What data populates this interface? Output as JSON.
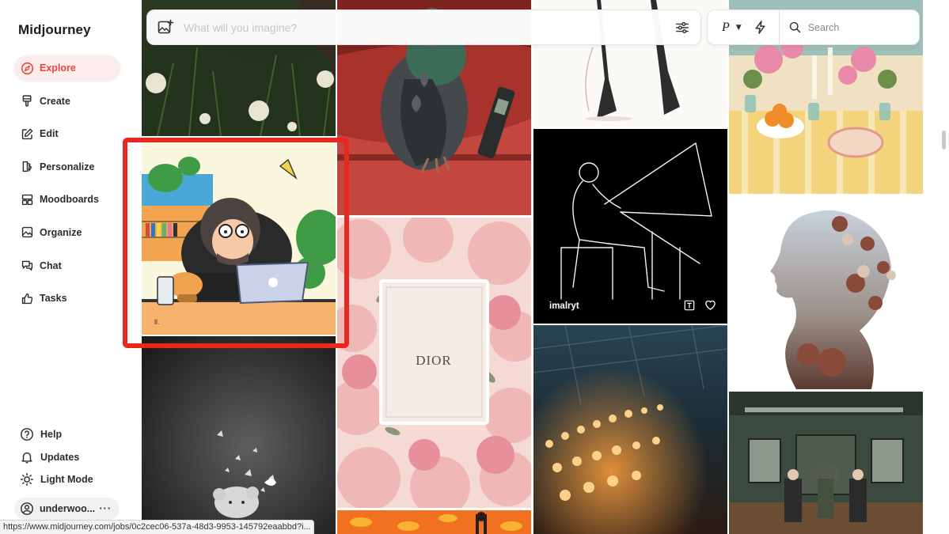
{
  "app": {
    "logo": "Midjourney"
  },
  "sidebar": {
    "items": [
      {
        "label": "Explore",
        "icon": "compass-icon",
        "active": true
      },
      {
        "label": "Create",
        "icon": "brush-icon",
        "active": false
      },
      {
        "label": "Edit",
        "icon": "edit-icon",
        "active": false
      },
      {
        "label": "Personalize",
        "icon": "personalize-icon",
        "active": false
      },
      {
        "label": "Moodboards",
        "icon": "moodboard-icon",
        "active": false
      },
      {
        "label": "Organize",
        "icon": "image-icon",
        "active": false
      },
      {
        "label": "Chat",
        "icon": "chat-icon",
        "active": false
      },
      {
        "label": "Tasks",
        "icon": "thumbs-up-icon",
        "active": false
      }
    ],
    "bottom": [
      {
        "label": "Help",
        "icon": "help-icon"
      },
      {
        "label": "Updates",
        "icon": "bell-icon"
      },
      {
        "label": "Light Mode",
        "icon": "sun-icon"
      }
    ],
    "user": {
      "name": "underwoo...",
      "more": "···"
    }
  },
  "topbar": {
    "prompt_placeholder": "What will you imagine?",
    "personalize_label": "P",
    "search_placeholder": "Search"
  },
  "feed": {
    "hover_card": {
      "user": "imalryt"
    },
    "tile_text": {
      "dior": "DIOR",
      "comic_sign": "ll."
    }
  },
  "status_url": "https://www.midjourney.com/jobs/0c2cec06-537a-48d3-9953-145792eaabbd?i...",
  "colors": {
    "accent": "#e8453c",
    "highlight": "#e8281e"
  }
}
